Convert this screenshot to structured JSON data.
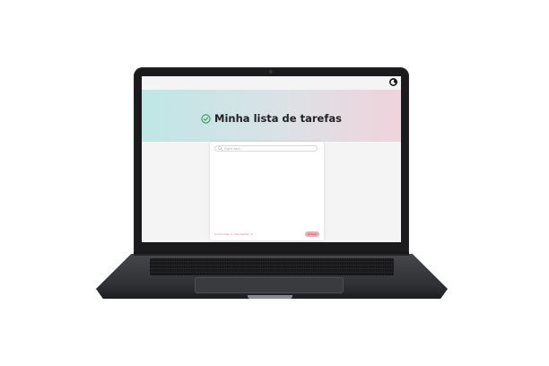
{
  "app": {
    "title": "Minha lista de tarefas",
    "search_placeholder": "Digite aqui...",
    "footer_status": "Concluídas: 0 | Pendentes: 0",
    "clear_label": "Limpar",
    "theme_toggle_icon": "moon-icon",
    "title_icon": "check-circle-icon"
  },
  "colors": {
    "accent": "#2e9e55",
    "hero_start": "#bfe6e6",
    "hero_end": "#f0d3dc",
    "clear_button": "#f2a9b2"
  }
}
